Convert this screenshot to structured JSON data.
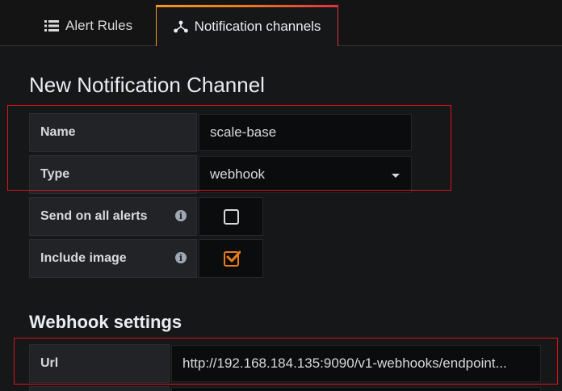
{
  "tabs": [
    {
      "label": "Alert Rules",
      "icon": "list-icon"
    },
    {
      "label": "Notification channels",
      "icon": "sitemap-icon",
      "active": true
    }
  ],
  "page_title": "New Notification Channel",
  "form": {
    "name_label": "Name",
    "name_value": "scale-base",
    "type_label": "Type",
    "type_value": "webhook",
    "send_all_label": "Send on all alerts",
    "send_all_checked": false,
    "include_image_label": "Include image",
    "include_image_checked": true
  },
  "webhook": {
    "section_title": "Webhook settings",
    "url_label": "Url",
    "url_value": "http://192.168.184.135:9090/v1-webhooks/endpoint..."
  },
  "colors": {
    "accent": "#eb7b18",
    "highlight": "#d9141a",
    "background": "#161719"
  }
}
